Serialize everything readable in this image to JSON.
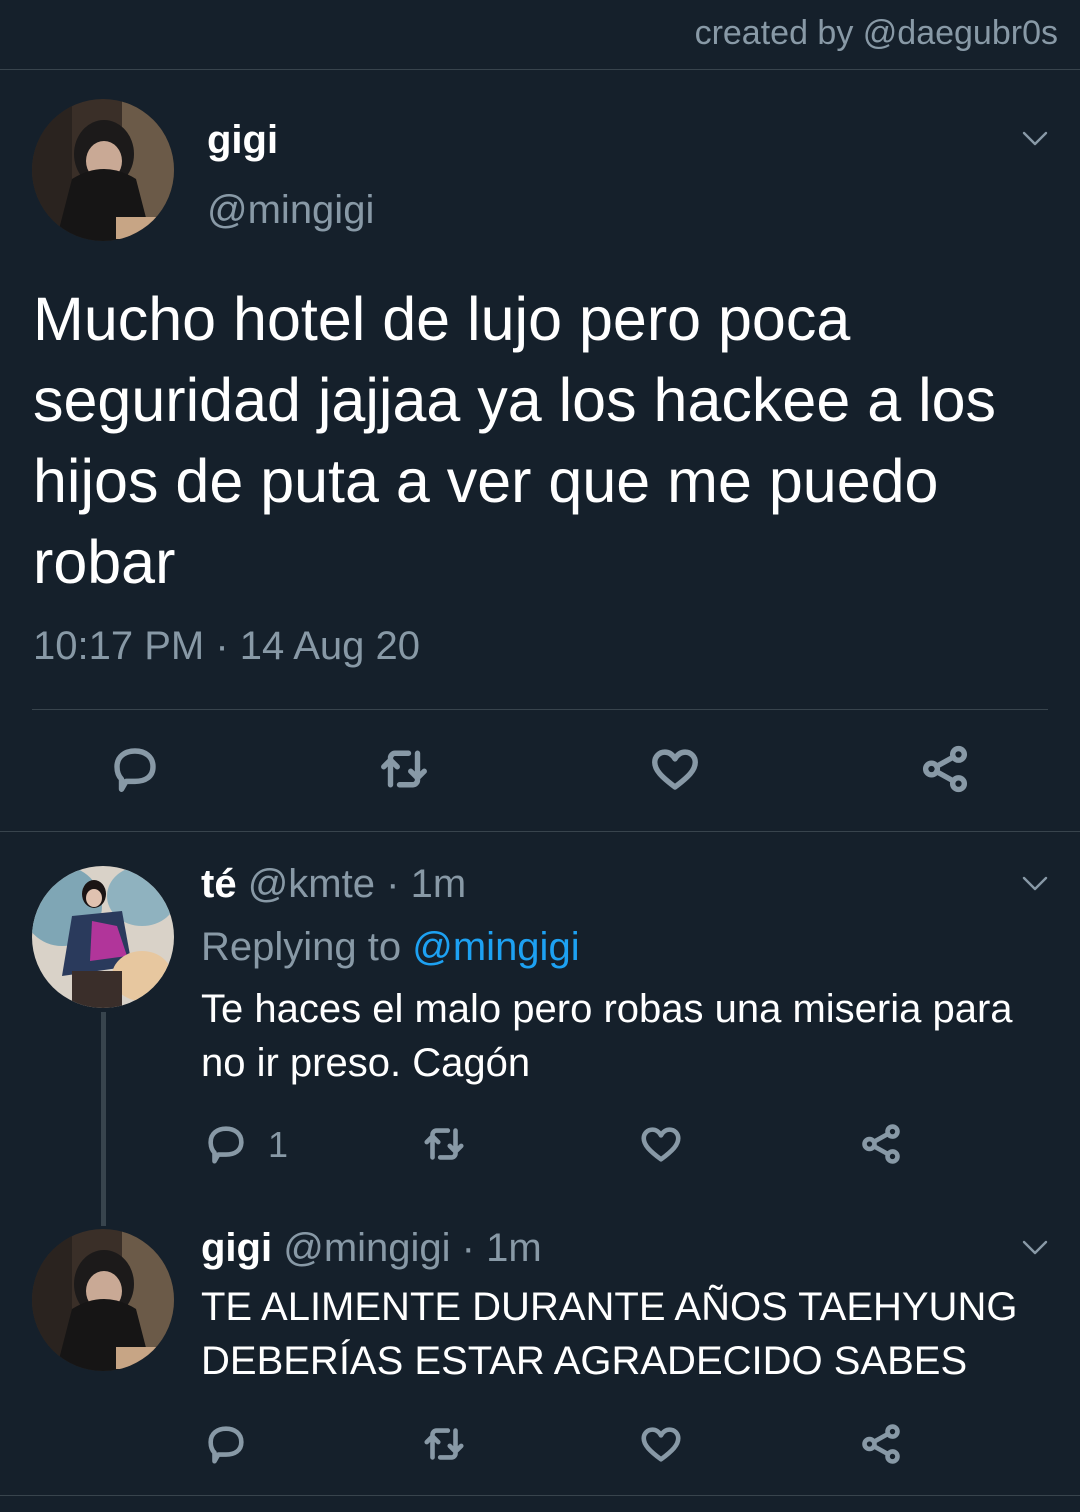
{
  "credit": "created by @daegubr0s",
  "main_tweet": {
    "name": "gigi",
    "handle": "@mingigi",
    "text": "Mucho hotel de lujo pero poca seguridad jajjaa ya los hackee a los hijos de puta a ver que me puedo robar",
    "time": "10:17 PM",
    "separator": "·",
    "date": "14 Aug 20",
    "icons": [
      "reply-icon",
      "retweet-icon",
      "like-icon",
      "share-icon"
    ]
  },
  "replies": [
    {
      "name": "té",
      "handle": "@kmte",
      "separator": "·",
      "age": "1m",
      "replying_prefix": "Replying to",
      "replying_to": "@mingigi",
      "text": "Te haces el malo pero robas una miseria para no ir preso. Cagón",
      "reply_count": "1"
    },
    {
      "name": "gigi",
      "handle": "@mingigi",
      "separator": "·",
      "age": "1m",
      "text": "TE ALIMENTE DURANTE AÑOS TAEHYUNG DEBERÍAS ESTAR AGRADECIDO SABES"
    }
  ],
  "colors": {
    "background": "#15202b",
    "muted": "#8899a6",
    "divider": "#38444d",
    "link": "#1da1f2"
  }
}
